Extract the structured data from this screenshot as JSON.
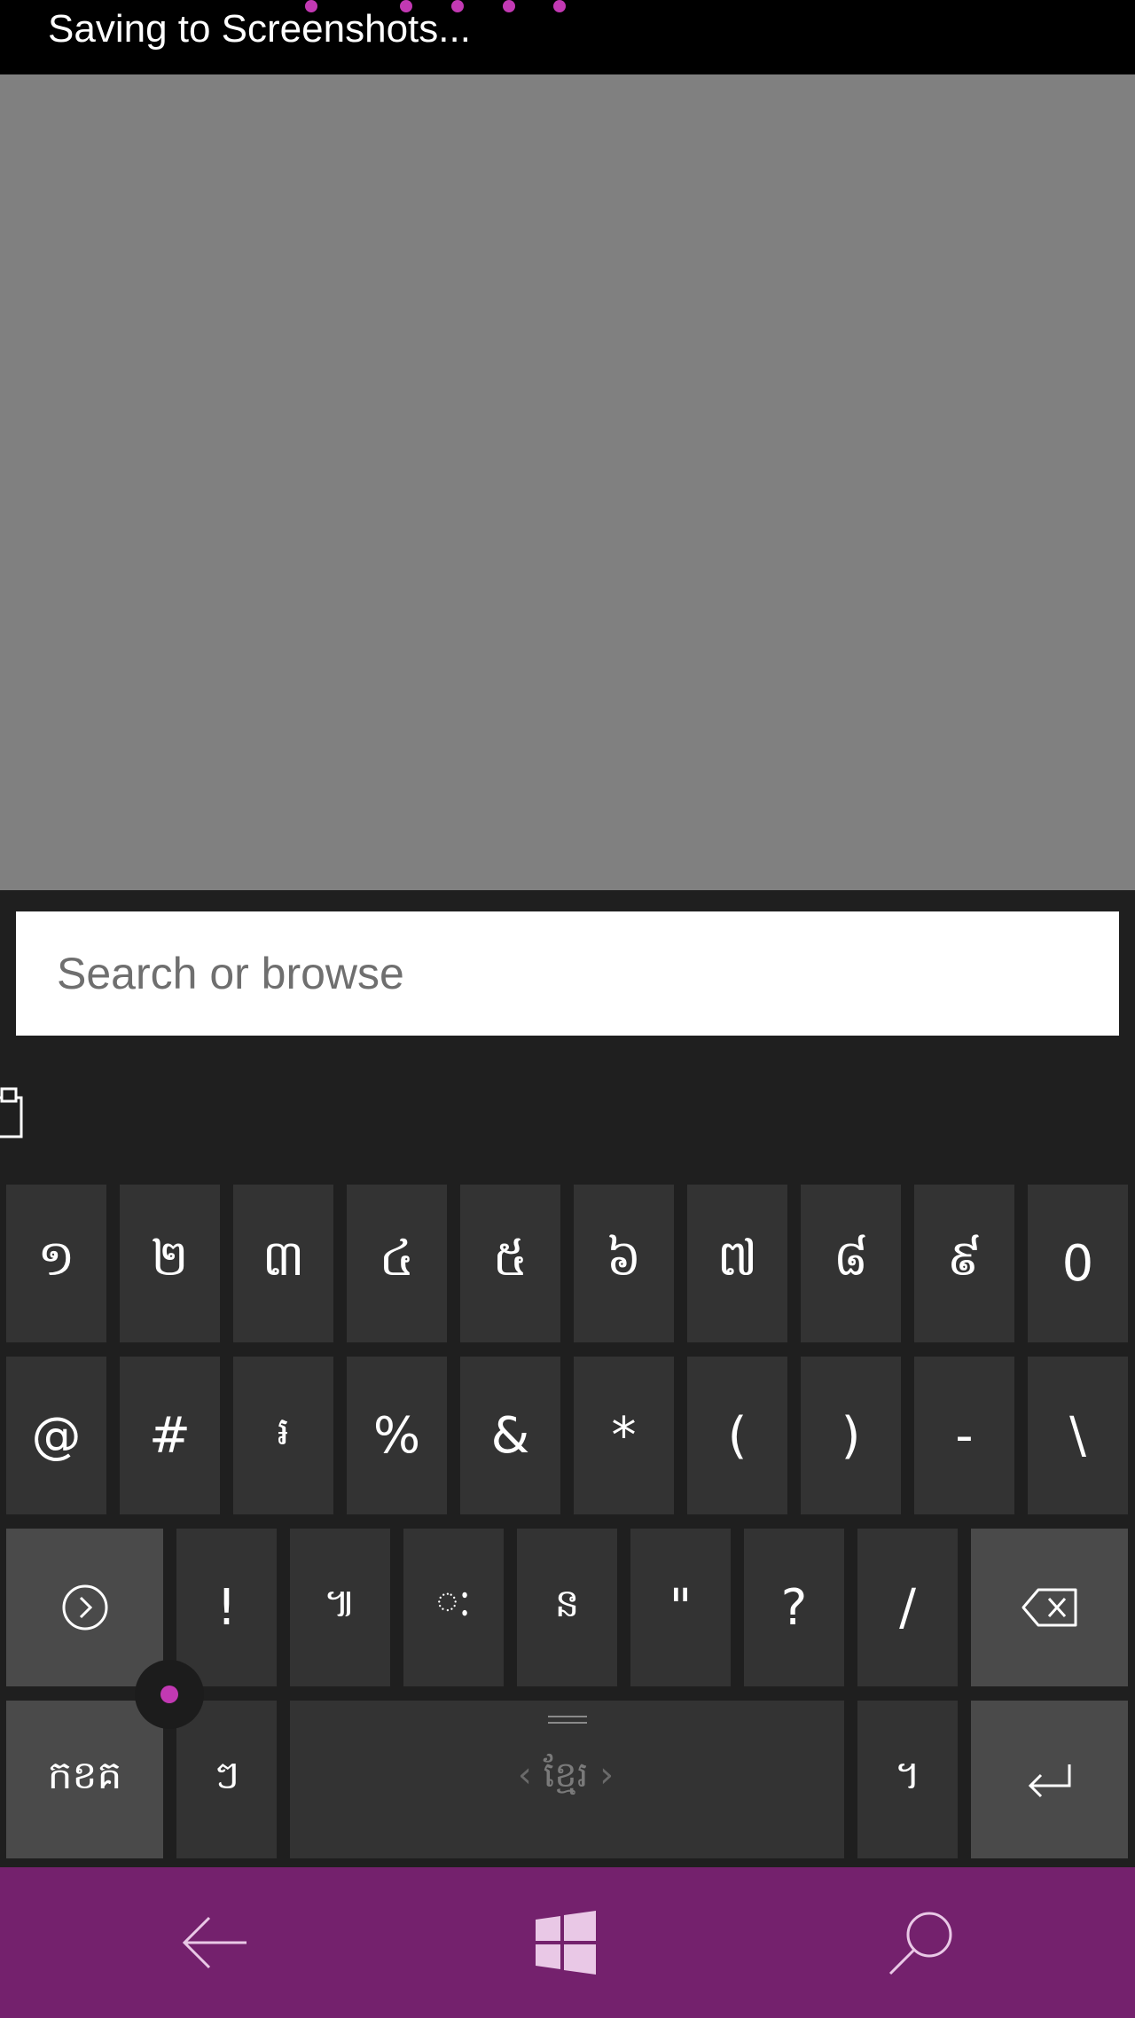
{
  "status": {
    "text": "Saving to Screenshots..."
  },
  "search": {
    "placeholder": "Search or browse"
  },
  "keyboard": {
    "row1": [
      "១",
      "២",
      "៣",
      "៤",
      "៥",
      "៦",
      "៧",
      "៨",
      "៩",
      "0"
    ],
    "row2": [
      "@",
      "#",
      "៛",
      "%",
      "&",
      "*",
      "(",
      ")",
      "-",
      "\\"
    ],
    "row3": [
      "!",
      "៕",
      "ៈ",
      "ន",
      "\"",
      "?",
      "/"
    ],
    "layout_key": "កខគ",
    "row4_left": "ៗ",
    "row4_right": "។",
    "language_label": "ខ្មែរ",
    "lang_prev": "‹",
    "lang_next": "›"
  },
  "colors": {
    "accent": "#c239b3",
    "navbar": "#74216d",
    "key": "#333333",
    "key_function": "#4a4a4a"
  },
  "icons": [
    "clipboard-icon",
    "next-arrow-icon",
    "backspace-icon",
    "enter-icon",
    "back-arrow-icon",
    "windows-icon",
    "search-icon"
  ]
}
